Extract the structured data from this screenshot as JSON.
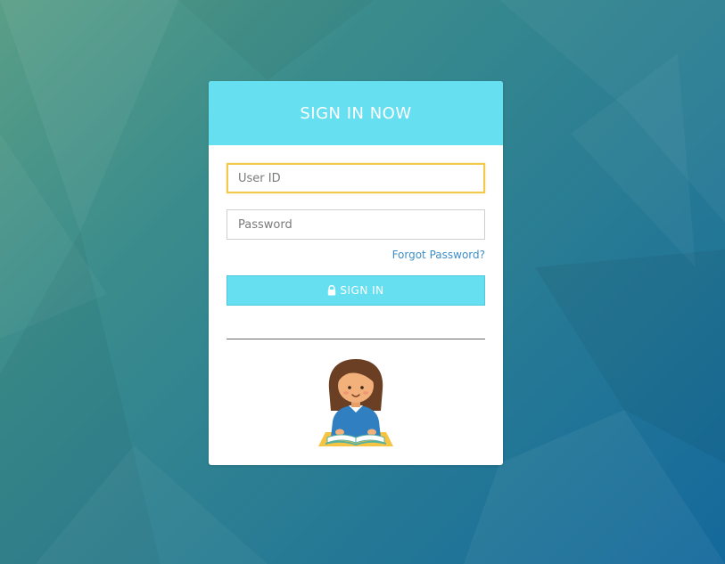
{
  "login": {
    "title": "SIGN IN NOW",
    "user_id_placeholder": "User ID",
    "password_placeholder": "Password",
    "forgot_password": "Forgot Password?",
    "sign_in_label": "SIGN IN"
  },
  "icons": {
    "sign_in_icon": "lock-icon",
    "illustration": "girl-reading-book-illustration"
  },
  "colors": {
    "accent": "#66dff0",
    "focus_border": "#f2c94c",
    "link": "#3e8ec6",
    "background_start": "#5a9e86",
    "background_end": "#14699c"
  }
}
